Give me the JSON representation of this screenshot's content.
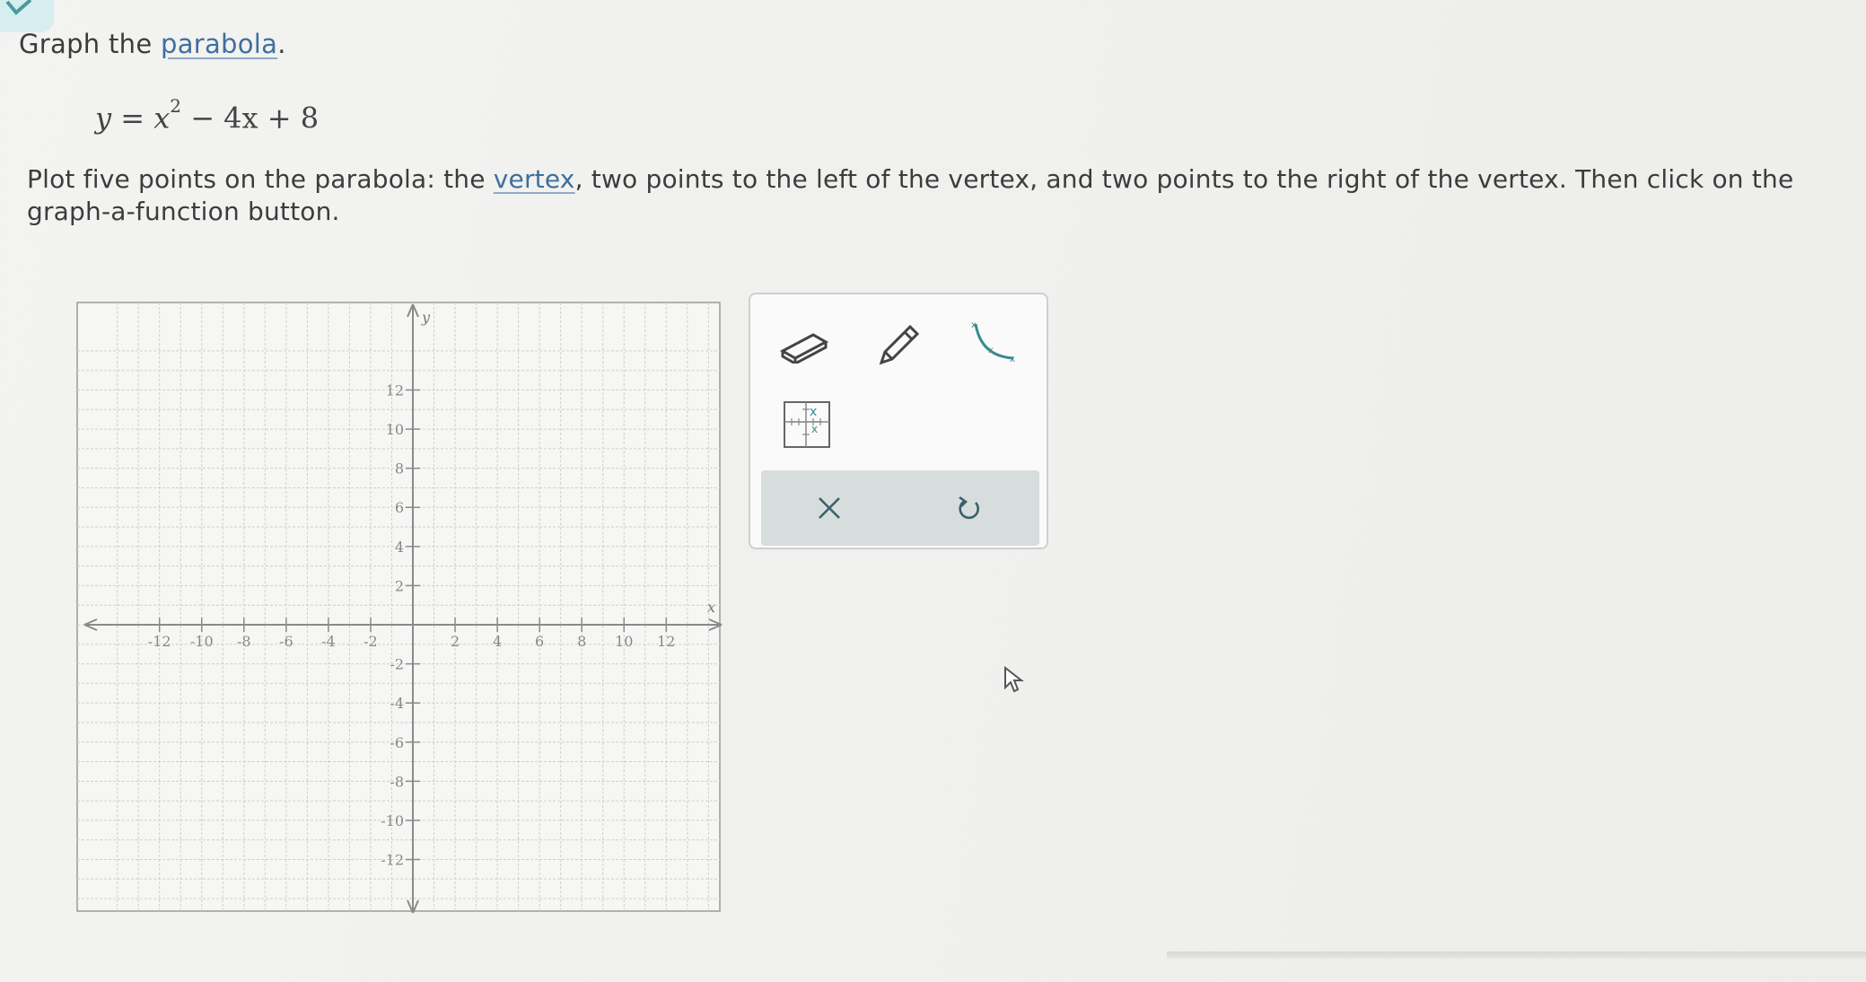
{
  "question": {
    "prefix": "Graph the ",
    "link_parabola": "parabola",
    "suffix": ".",
    "equation": {
      "lhs": "y",
      "eq": " = ",
      "x": "x",
      "power": "2",
      "rest": " − 4x + 8"
    },
    "instruction_prefix": "Plot five points on the parabola: the ",
    "link_vertex": "vertex",
    "instruction_suffix": ", two points to the left of the vertex, and two points to the right of the vertex. Then click on the graph-a-function button."
  },
  "graph": {
    "x_label": "x",
    "y_label": "y",
    "x_ticks": [
      "-12",
      "-10",
      "-8",
      "-6",
      "-4",
      "-2",
      "2",
      "4",
      "6",
      "8",
      "10",
      "12"
    ],
    "y_ticks": [
      "12",
      "10",
      "8",
      "6",
      "4",
      "2",
      "-2",
      "-4",
      "-6",
      "-8",
      "-10",
      "-12"
    ],
    "range": [
      -14,
      14
    ]
  },
  "toolbar": {
    "tools": [
      "eraser-icon",
      "pencil-icon",
      "parabola-tool-icon",
      "graph-a-function-icon"
    ],
    "actions": [
      "clear-icon",
      "undo-icon"
    ]
  },
  "colors": {
    "teal": "#3a8a8e",
    "link": "#3f6f9e",
    "grid": "#c9c9c9",
    "axis": "#8a8a8a"
  }
}
